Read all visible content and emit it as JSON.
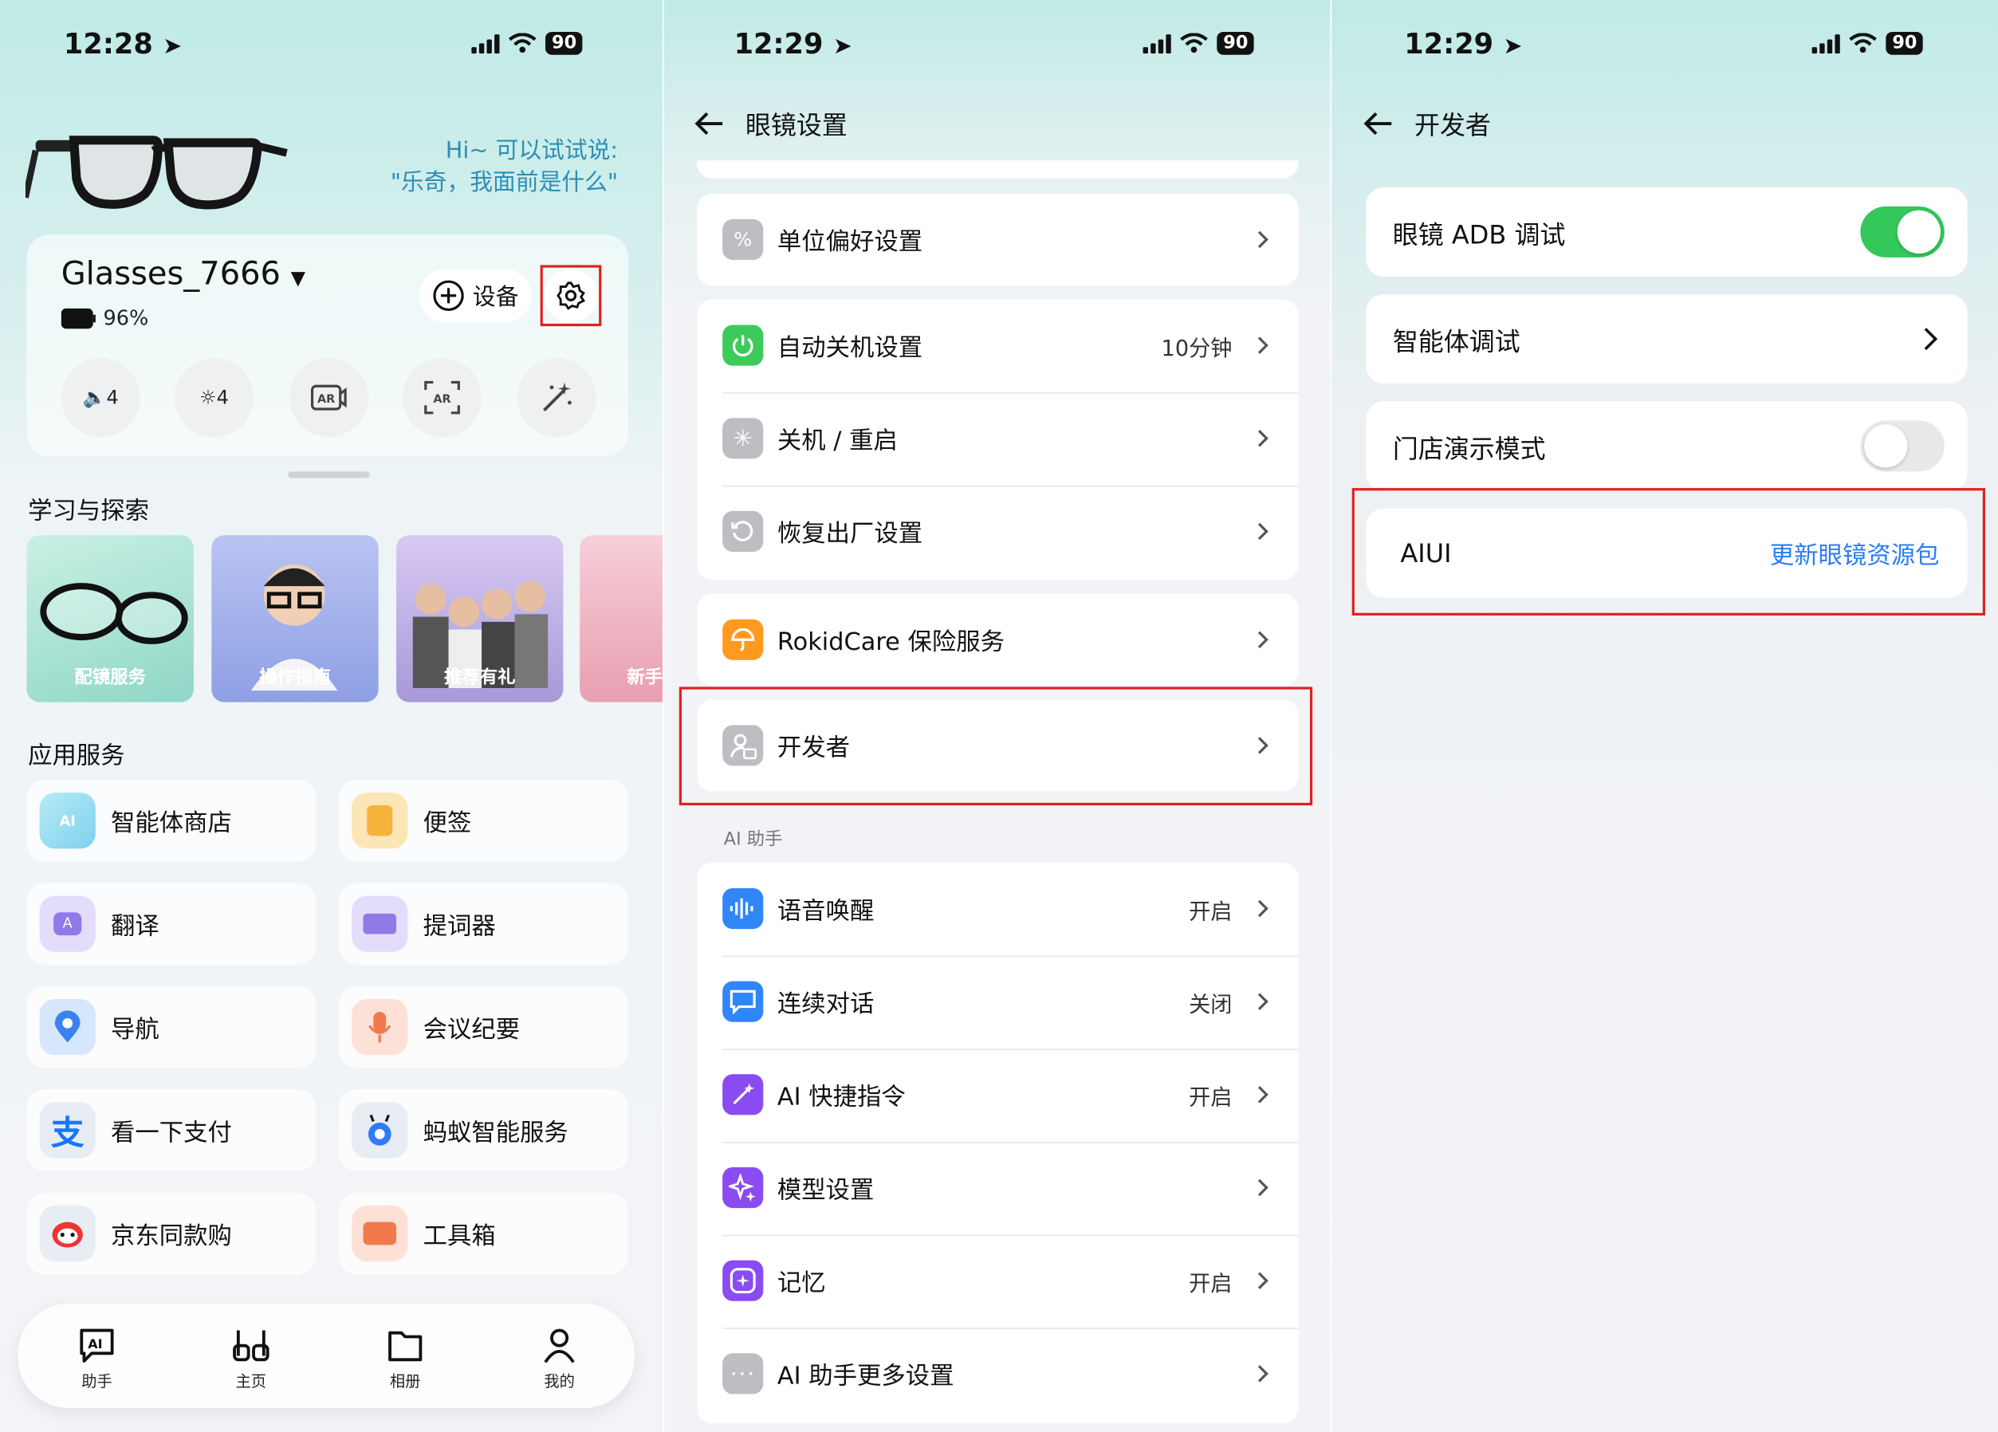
{
  "screen1": {
    "status": {
      "time": "12:28",
      "battery": "90"
    },
    "hint_line1": "Hi~ 可以试试说:",
    "hint_line2": "\"乐奇，我面前是什么\"",
    "device": {
      "name": "Glasses_7666",
      "battery": "96%",
      "add_device_label": "设备"
    },
    "controls": {
      "volume": "4",
      "brightness": "4"
    },
    "learn_title": "学习与探索",
    "learn_cards": [
      "配镜服务",
      "操作指南",
      "推荐有礼",
      "新手"
    ],
    "services_title": "应用服务",
    "services": [
      "智能体商店",
      "便签",
      "翻译",
      "提词器",
      "导航",
      "会议纪要",
      "看一下支付",
      "蚂蚁智能服务",
      "京东同款购",
      "工具箱"
    ],
    "tabs": [
      "助手",
      "主页",
      "相册",
      "我的"
    ]
  },
  "screen2": {
    "status": {
      "time": "12:29",
      "battery": "90"
    },
    "title": "眼镜设置",
    "items": {
      "units": "单位偏好设置",
      "auto_off": "自动关机设置",
      "auto_off_value": "10分钟",
      "power": "关机 / 重启",
      "factory": "恢复出厂设置",
      "care": "RokidCare 保险服务",
      "developer": "开发者"
    },
    "ai_section": "AI 助手",
    "ai_items": {
      "wake": "语音唤醒",
      "wake_value": "开启",
      "dialog": "连续对话",
      "dialog_value": "关闭",
      "shortcut": "AI 快捷指令",
      "shortcut_value": "开启",
      "model": "模型设置",
      "memory": "记忆",
      "memory_value": "开启",
      "more": "AI 助手更多设置"
    }
  },
  "screen3": {
    "status": {
      "time": "12:29",
      "battery": "90"
    },
    "title": "开发者",
    "adb": "眼镜 ADB 调试",
    "agent": "智能体调试",
    "store_demo": "门店演示模式",
    "aiui": "AIUI",
    "aiui_action": "更新眼镜资源包"
  },
  "colors": {
    "accent_green": "#34c759",
    "link_blue": "#2a7cf6",
    "highlight_red": "#e02020"
  }
}
